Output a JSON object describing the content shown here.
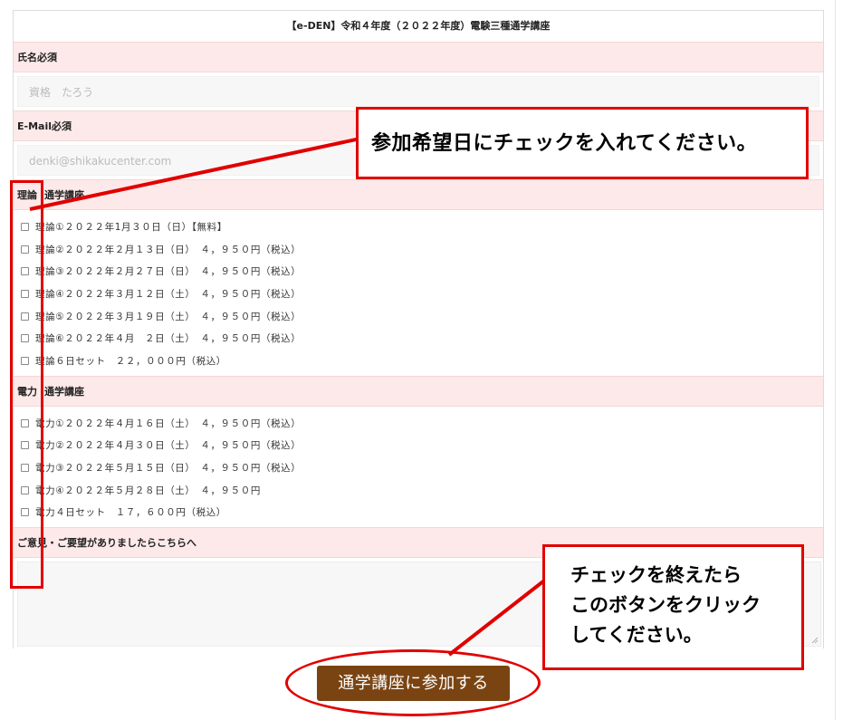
{
  "form": {
    "title": "【e-DEN】令和４年度（２０２２年度）電験三種通学講座",
    "name_label": "氏名必須",
    "name_placeholder": "資格　たろう",
    "email_label": "E-Mail必須",
    "email_placeholder": "denki@shikakucenter.com",
    "theory": {
      "label": "理論",
      "sub": "通学講座",
      "options": [
        "理論①２０２２年1月３０日（日）【無料】",
        "理論②２０２２年２月１３日（日）　４，９５０円（税込）",
        "理論③２０２２年２月２７日（日）　４，９５０円（税込）",
        "理論④２０２２年３月１２日（土）　４，９５０円（税込）",
        "理論⑤２０２２年３月１９日（土）　４，９５０円（税込）",
        "理論⑥２０２２年４月　２日（土）　４，９５０円（税込）",
        "理論６日セット　２２，０００円（税込）"
      ]
    },
    "power": {
      "label": "電力",
      "sub": "通学講座",
      "options": [
        "電力①２０２２年４月１６日（土）　４，９５０円（税込）",
        "電力②２０２２年４月３０日（土）　４，９５０円（税込）",
        "電力③２０２２年５月１５日（日）　４，９５０円（税込）",
        "電力④２０２２年５月２８日（土）　４，９５０円",
        "電力４日セット　１７，６００円（税込）"
      ]
    },
    "comment_label": "ご意見・ご要望がありましたらこちらへ",
    "submit_label": "通学講座に参加する"
  },
  "annotations": {
    "top_callout": "参加希望日にチェックを入れてください。",
    "bottom_callout": [
      "チェックを終えたら",
      "このボタンをクリック",
      "してください。"
    ],
    "accent_color": "#e10000"
  },
  "colors": {
    "section_bg": "#fde9e9",
    "button_bg": "#7a4412"
  }
}
